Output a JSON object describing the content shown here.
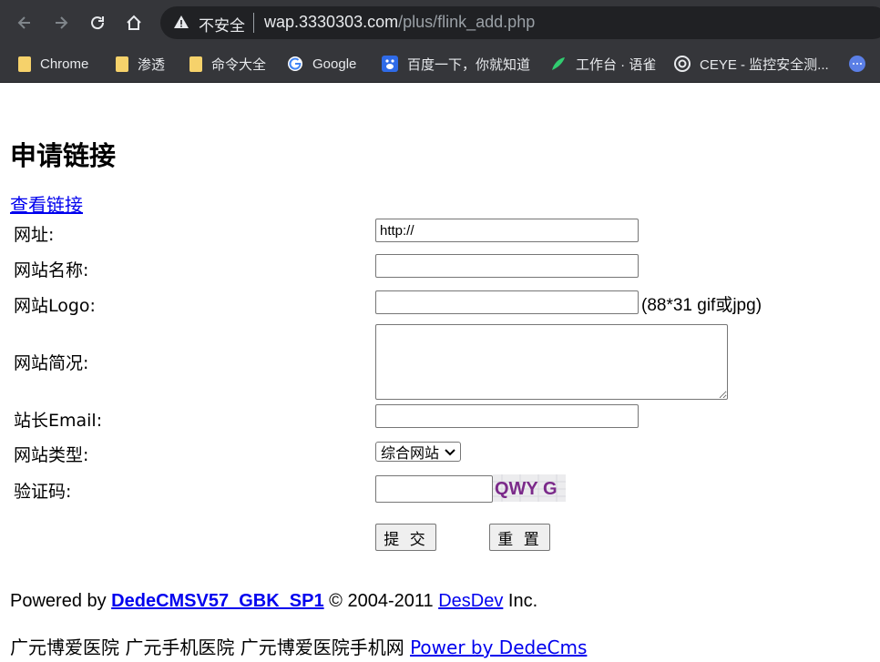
{
  "browser": {
    "insecure_label": "不安全",
    "url_host": "wap.3330303.com",
    "url_path": "/plus/flink_add.php",
    "bookmarks": [
      {
        "label": "Chrome",
        "icon": "folder-icon"
      },
      {
        "label": "渗透",
        "icon": "folder-icon"
      },
      {
        "label": "命令大全",
        "icon": "folder-icon"
      },
      {
        "label": "Google",
        "icon": "google-icon"
      },
      {
        "label": "百度一下，你就知道",
        "icon": "baidu-icon"
      },
      {
        "label": "工作台 · 语雀",
        "icon": "yuque-icon"
      },
      {
        "label": "CEYE - 监控安全测...",
        "icon": "ceye-icon"
      }
    ]
  },
  "page": {
    "title": "申请链接",
    "view_links": "查看链接",
    "form": {
      "url_label": "网址:",
      "url_value": "http://",
      "site_name_label": "网站名称:",
      "logo_label": "网站Logo:",
      "logo_hint": "(88*31 gif或jpg)",
      "description_label": "网站简况:",
      "email_label": "站长Email:",
      "type_label": "网站类型:",
      "type_selected": "综合网站",
      "captcha_label": "验证码:",
      "captcha_text": "QWY G",
      "submit": "提 交",
      "reset": "重 置"
    },
    "footer": {
      "powered_prefix": "Powered by ",
      "powered_link": "DedeCMSV57_GBK_SP1",
      "copyright": " © 2004-2011 ",
      "desdev_link": "DesDev",
      "inc": " Inc.",
      "hospitals": "广元博爱医院 广元手机医院 广元博爱医院手机网 ",
      "dedecms_link": "Power by DedeCms"
    }
  },
  "colors": {
    "link": "#0000ee",
    "chrome_bg": "#35363a",
    "omnibox_bg": "#202124"
  }
}
